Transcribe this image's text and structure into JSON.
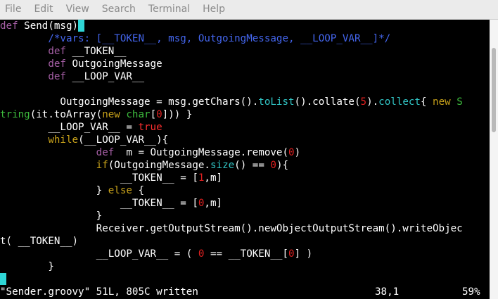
{
  "menu": [
    "File",
    "Edit",
    "View",
    "Search",
    "Terminal",
    "Help"
  ],
  "editor": {
    "lines": [
      [
        {
          "t": "def",
          "c": "kw"
        },
        {
          "t": " Send(msg)",
          "c": ""
        },
        {
          "t": " ",
          "c": "cursor"
        }
      ],
      [
        {
          "t": "        /*vars: [__TOKEN__, msg, OutgoingMessage, __LOOP_VAR__]*/",
          "c": "cm"
        }
      ],
      [
        {
          "t": "        ",
          "c": ""
        },
        {
          "t": "def",
          "c": "kw"
        },
        {
          "t": " __TOKEN__",
          "c": ""
        }
      ],
      [
        {
          "t": "        ",
          "c": ""
        },
        {
          "t": "def",
          "c": "kw"
        },
        {
          "t": " OutgoingMessage",
          "c": ""
        }
      ],
      [
        {
          "t": "        ",
          "c": ""
        },
        {
          "t": "def",
          "c": "kw"
        },
        {
          "t": " __LOOP_VAR__",
          "c": ""
        }
      ],
      [
        {
          "t": "",
          "c": ""
        }
      ],
      [
        {
          "t": "          OutgoingMessage = msg.getChars().",
          "c": ""
        },
        {
          "t": "toList",
          "c": "fn"
        },
        {
          "t": "().collate(",
          "c": ""
        },
        {
          "t": "5",
          "c": "nm"
        },
        {
          "t": ").",
          "c": ""
        },
        {
          "t": "collect",
          "c": "fn"
        },
        {
          "t": "{ ",
          "c": ""
        },
        {
          "t": "new",
          "c": "nw"
        },
        {
          "t": " S",
          "c": "cls"
        }
      ],
      [
        {
          "t": "tring",
          "c": "cls"
        },
        {
          "t": "(it.toArray(",
          "c": ""
        },
        {
          "t": "new",
          "c": "nw"
        },
        {
          "t": " ",
          "c": ""
        },
        {
          "t": "char",
          "c": "cls"
        },
        {
          "t": "[",
          "c": ""
        },
        {
          "t": "0",
          "c": "nm"
        },
        {
          "t": "])) }",
          "c": ""
        }
      ],
      [
        {
          "t": "        __LOOP_VAR__ = ",
          "c": ""
        },
        {
          "t": "true",
          "c": "tr"
        }
      ],
      [
        {
          "t": "        ",
          "c": ""
        },
        {
          "t": "while",
          "c": "nw"
        },
        {
          "t": "(__LOOP_VAR__){",
          "c": ""
        }
      ],
      [
        {
          "t": "                ",
          "c": ""
        },
        {
          "t": "def",
          "c": "kw"
        },
        {
          "t": "  m = OutgoingMessage.remove(",
          "c": ""
        },
        {
          "t": "0",
          "c": "nm"
        },
        {
          "t": ")",
          "c": ""
        }
      ],
      [
        {
          "t": "                ",
          "c": ""
        },
        {
          "t": "if",
          "c": "nw"
        },
        {
          "t": "(OutgoingMessage.",
          "c": ""
        },
        {
          "t": "size",
          "c": "fn"
        },
        {
          "t": "() == ",
          "c": ""
        },
        {
          "t": "0",
          "c": "nm"
        },
        {
          "t": "){",
          "c": ""
        }
      ],
      [
        {
          "t": "                    __TOKEN__ = [",
          "c": ""
        },
        {
          "t": "1",
          "c": "nm"
        },
        {
          "t": ",m]",
          "c": ""
        }
      ],
      [
        {
          "t": "                } ",
          "c": ""
        },
        {
          "t": "else",
          "c": "nw"
        },
        {
          "t": " {",
          "c": ""
        }
      ],
      [
        {
          "t": "                    __TOKEN__ = [",
          "c": ""
        },
        {
          "t": "0",
          "c": "nm"
        },
        {
          "t": ",m]",
          "c": ""
        }
      ],
      [
        {
          "t": "                }",
          "c": ""
        }
      ],
      [
        {
          "t": "                Receiver.getOutputStream().newObjectOutputStream().writeObjec",
          "c": ""
        }
      ],
      [
        {
          "t": "t( __TOKEN__)",
          "c": ""
        }
      ],
      [
        {
          "t": "                __LOOP_VAR__ = ( ",
          "c": ""
        },
        {
          "t": "0",
          "c": "nm"
        },
        {
          "t": " == __TOKEN__[",
          "c": ""
        },
        {
          "t": "0",
          "c": "nm"
        },
        {
          "t": "] )",
          "c": ""
        }
      ],
      [
        {
          "t": "        }",
          "c": ""
        }
      ],
      [
        {
          "t": " ",
          "c": "cursor"
        }
      ]
    ]
  },
  "status": {
    "file_msg": "\"Sender.groovy\" 51L, 805C written",
    "position": "38,1",
    "percent": "59%"
  }
}
